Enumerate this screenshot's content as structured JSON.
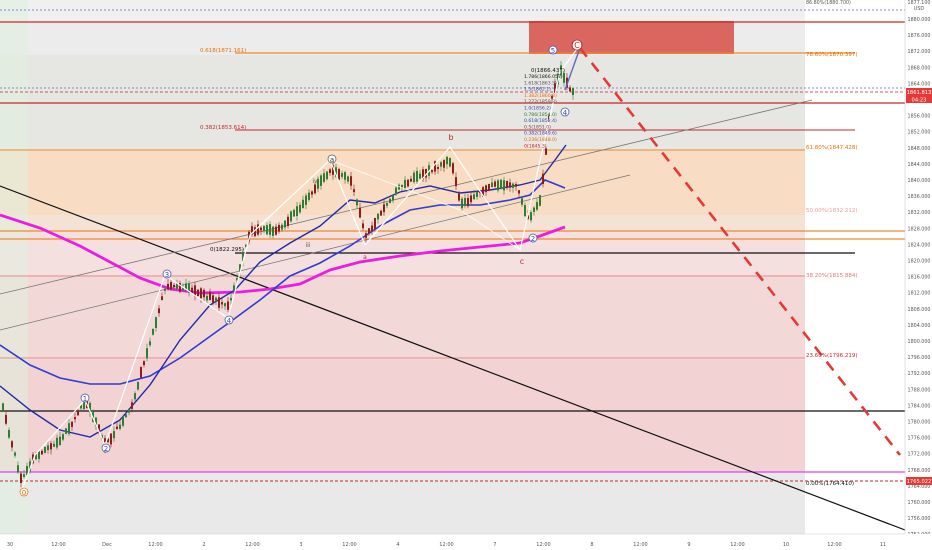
{
  "app": {
    "top_label": "86.80%(1880.700)",
    "top_right_badge": "1877.100",
    "top_right_small": "USD"
  },
  "price_axis": {
    "ticks": [
      "1880.000",
      "1876.000",
      "1872.000",
      "1868.000",
      "1864.000",
      "1860.000",
      "1856.000",
      "1852.000",
      "1848.000",
      "1844.000",
      "1840.000",
      "1836.000",
      "1832.000",
      "1828.000",
      "1824.000",
      "1820.000",
      "1816.000",
      "1812.000",
      "1808.000",
      "1804.000",
      "1800.000",
      "1796.000",
      "1792.000",
      "1788.000",
      "1784.000",
      "1780.000",
      "1776.000",
      "1772.000",
      "1768.000",
      "1764.000",
      "1760.000",
      "1756.000",
      "1752.000"
    ],
    "last_price": "1861.813",
    "countdown": "04:23",
    "low_level_badge": "1765.022"
  },
  "time_axis": {
    "labels": [
      "30",
      "12:00",
      "Dec",
      "12:00",
      "2",
      "12:00",
      "3",
      "12:00",
      "4",
      "12:00",
      "7",
      "12:00",
      "8",
      "12:00",
      "9",
      "12:00",
      "10",
      "12:00",
      "11"
    ]
  },
  "fib_labels": {
    "f0618_left": "0.618(1871.161)",
    "f0786_right": "78.60%(1870.397)",
    "f0382_left": "0.382(1853.614)",
    "f618_right": "61.80%(1847.428)",
    "f50_right": "50.00%(1832.212)",
    "f382_right": "38.20%(1815.884)",
    "f236_right": "23.60%(1796.219)",
    "f0_right": "0.00%(1764.410)",
    "zero_left": "0(1822.295)",
    "zero_top": "0(1866.437)"
  },
  "fib_ladder": [
    "1.786(1866.057)",
    "1.618(1863.5)",
    "1.5(1862.1)",
    "1.382(1860.8)",
    "1.272(1859.3)",
    "1.0(1856.2)",
    "0.786(1854.0)",
    "0.618(1852.4)",
    "0.5(1851.0)",
    "0.382(1849.6)",
    "0.236(1848.0)",
    "0(1845.3)"
  ],
  "wave_labels": {
    "w_c_big": "(C)",
    "w_a_circ": "a",
    "w_b": "b",
    "w_c_small": "c",
    "w_1": "1",
    "w_2": "2",
    "w_3": "3",
    "w_4": "4",
    "w_5": "5",
    "w_0": "0",
    "w_iii": "iii",
    "w_iv": "iv",
    "w_a": "a"
  }
}
